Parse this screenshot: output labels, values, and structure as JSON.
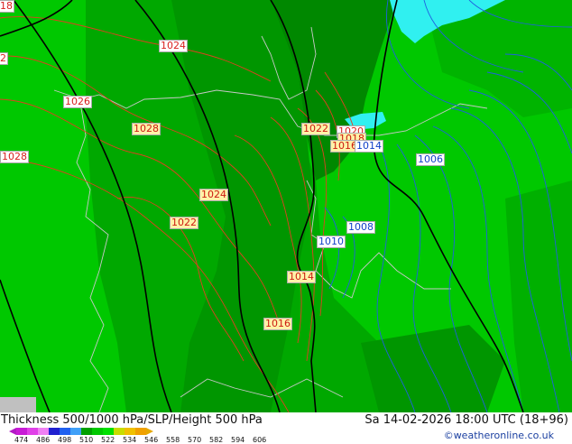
{
  "footer": {
    "title": "Thickness 500/1000 hPa/SLP/Height 500 hPa",
    "datetime": "Sa 14-02-2026 18:00 UTC (18+96)",
    "credit": "©weatheronline.co.uk"
  },
  "colorscale": {
    "ticks": [
      "474",
      "486",
      "498",
      "510",
      "522",
      "534",
      "546",
      "558",
      "570",
      "582",
      "594",
      "606"
    ],
    "colors": [
      "#c81bd6",
      "#e040e8",
      "#f080f4",
      "#2020d0",
      "#2060f0",
      "#40a0f8",
      "#00a000",
      "#00c800",
      "#00e000",
      "#c8dc00",
      "#f0c000",
      "#f0a000"
    ]
  },
  "map_colors": {
    "light_green": "#00c800",
    "mid_green": "#00a800",
    "dark_green": "#008c00",
    "lake_cyan": "#30f0f0",
    "sea_gray": "#c0c0c0",
    "isobar_red": "#e04020",
    "isobar_blue": "#2060e0",
    "height_black": "#000000",
    "coastline": "#c8c8c8"
  },
  "labels": [
    {
      "text": "18",
      "style": "red"
    },
    {
      "text": "1024",
      "style": "red"
    },
    {
      "text": "2",
      "style": "red"
    },
    {
      "text": "1026",
      "style": "red"
    },
    {
      "text": "1028",
      "style": "ylw"
    },
    {
      "text": "1028",
      "style": "red"
    },
    {
      "text": "1022",
      "style": "ylw"
    },
    {
      "text": "1020",
      "style": "red"
    },
    {
      "text": "1018",
      "style": "ylw"
    },
    {
      "text": "1016",
      "style": "ylw"
    },
    {
      "text": "1014",
      "style": "blu"
    },
    {
      "text": "1006",
      "style": "blu"
    },
    {
      "text": "1024",
      "style": "ylw"
    },
    {
      "text": "1022",
      "style": "ylw"
    },
    {
      "text": "1008",
      "style": "blu"
    },
    {
      "text": "1010",
      "style": "blu"
    },
    {
      "text": "1014",
      "style": "ylw"
    },
    {
      "text": "1016",
      "style": "ylw"
    }
  ]
}
